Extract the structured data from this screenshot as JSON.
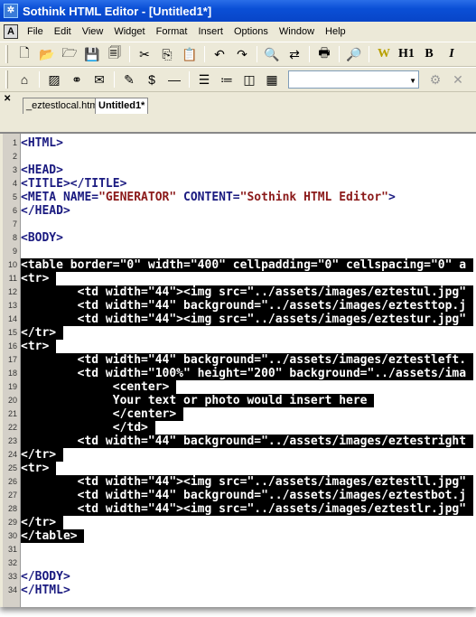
{
  "window": {
    "title": "Sothink HTML Editor - [Untitled1*]"
  },
  "menu": [
    "File",
    "Edit",
    "View",
    "Widget",
    "Format",
    "Insert",
    "Options",
    "Window",
    "Help"
  ],
  "toolbar1": [
    "new-file",
    "open",
    "open-folder",
    "save",
    "save-all",
    "|",
    "cut",
    "copy",
    "paste",
    "|",
    "undo",
    "redo",
    "|",
    "find",
    "replace",
    "|",
    "print",
    "|",
    "preview",
    "|",
    "wordart",
    "H1",
    "bold",
    "italic"
  ],
  "toolbar2": [
    "home",
    "|",
    "image",
    "link",
    "email",
    "|",
    "pencil",
    "money-bag",
    "horizontal-rule",
    "|",
    "form",
    "list",
    "layout",
    "table"
  ],
  "tabs": [
    {
      "label": "_eztestlocal.htm",
      "active": false
    },
    {
      "label": "Untitled1*",
      "active": true
    }
  ],
  "editor": {
    "selection_lines": [
      10,
      30
    ],
    "colors": {
      "tag": "#1a1a80",
      "value": "#8b1a1a",
      "selection": "#000000"
    },
    "lines": [
      [
        {
          "t": "<HTML>",
          "c": "tag"
        }
      ],
      [],
      [
        {
          "t": "<HEAD>",
          "c": "tag"
        }
      ],
      [
        {
          "t": "<TITLE></TITLE>",
          "c": "tag"
        }
      ],
      [
        {
          "t": "<META NAME=",
          "c": "tag"
        },
        {
          "t": "\"GENERATOR\"",
          "c": "val"
        },
        {
          "t": " CONTENT=",
          "c": "tag"
        },
        {
          "t": "\"Sothink HTML Editor\"",
          "c": "val"
        },
        {
          "t": ">",
          "c": "tag"
        }
      ],
      [
        {
          "t": "</HEAD>",
          "c": "tag"
        }
      ],
      [],
      [
        {
          "t": "<BODY>",
          "c": "tag"
        }
      ],
      [],
      [
        {
          "t": "<table border=\"0\" width=\"400\" cellpadding=\"0\" cellspacing=\"0\" a"
        }
      ],
      [
        {
          "t": "<tr>"
        }
      ],
      [
        {
          "t": "        <td width=\"44\"><img src=\"../assets/images/eztestul.jpg\""
        }
      ],
      [
        {
          "t": "        <td width=\"44\" background=\"../assets/images/eztesttop.j"
        }
      ],
      [
        {
          "t": "        <td width=\"44\"><img src=\"../assets/images/eztestur.jpg\""
        }
      ],
      [
        {
          "t": "</tr>"
        }
      ],
      [
        {
          "t": "<tr>"
        }
      ],
      [
        {
          "t": "        <td width=\"44\" background=\"../assets/images/eztestleft."
        }
      ],
      [
        {
          "t": "        <td width=\"100%\" height=\"200\" background=\"../assets/ima"
        }
      ],
      [
        {
          "t": "             <center>"
        }
      ],
      [
        {
          "t": "             Your text or photo would insert here"
        }
      ],
      [
        {
          "t": "             </center>"
        }
      ],
      [
        {
          "t": "             </td>"
        }
      ],
      [
        {
          "t": "        <td width=\"44\" background=\"../assets/images/eztestright"
        }
      ],
      [
        {
          "t": "</tr>"
        }
      ],
      [
        {
          "t": "<tr>"
        }
      ],
      [
        {
          "t": "        <td width=\"44\"><img src=\"../assets/images/eztestll.jpg\""
        }
      ],
      [
        {
          "t": "        <td width=\"44\" background=\"../assets/images/eztestbot.j"
        }
      ],
      [
        {
          "t": "        <td width=\"44\"><img src=\"../assets/images/eztestlr.jpg\""
        }
      ],
      [
        {
          "t": "</tr>"
        }
      ],
      [
        {
          "t": "</table>"
        }
      ],
      [],
      [],
      [
        {
          "t": "</BODY>",
          "c": "tag"
        }
      ],
      [
        {
          "t": "</HTML>",
          "c": "tag"
        }
      ]
    ]
  }
}
